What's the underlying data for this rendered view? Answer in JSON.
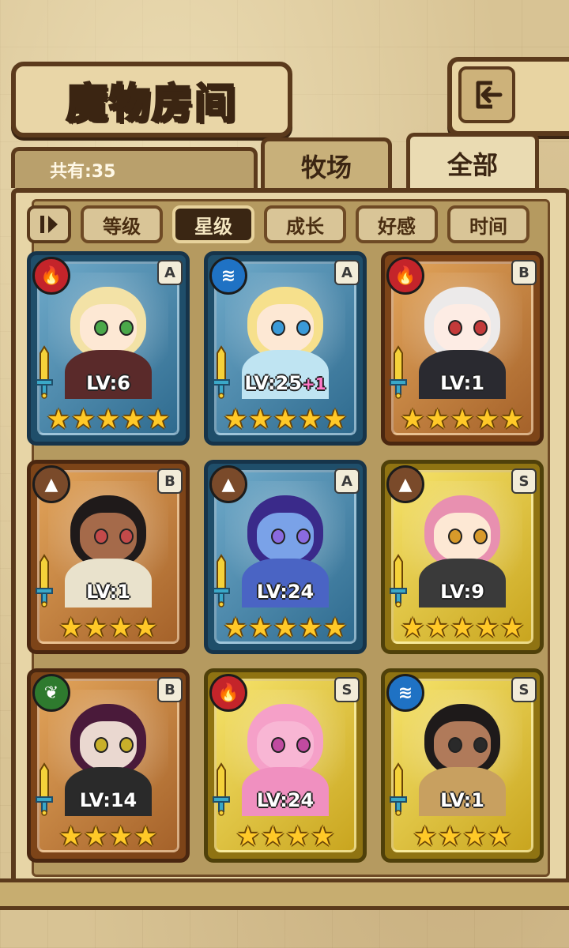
{
  "header": {
    "title": "魔物房间"
  },
  "tabs": {
    "farm": "牧场",
    "all": "全部"
  },
  "count": {
    "label": "共有:35"
  },
  "sort": {
    "buttons": [
      "等级",
      "星级",
      "成长",
      "好感",
      "时间"
    ],
    "active": "星级"
  },
  "colors": {
    "fire": "#c4242a",
    "water": "#1f72c4",
    "earth": "#7a4a2a",
    "wood": "#2e7a2e",
    "star": "#ffc928",
    "frame_dark": "#5b3a1c"
  },
  "monsters": [
    {
      "element": "fire-icon",
      "rank": "A",
      "level": "LV:6",
      "plus": "",
      "stars": 5
    },
    {
      "element": "water-icon",
      "rank": "A",
      "level": "LV:25",
      "plus": "+1",
      "stars": 5
    },
    {
      "element": "fire-icon",
      "rank": "B",
      "level": "LV:1",
      "plus": "",
      "stars": 5
    },
    {
      "element": "earth-icon",
      "rank": "B",
      "level": "LV:1",
      "plus": "",
      "stars": 4
    },
    {
      "element": "earth-icon",
      "rank": "A",
      "level": "LV:24",
      "plus": "",
      "stars": 5
    },
    {
      "element": "earth-icon",
      "rank": "S",
      "level": "LV:9",
      "plus": "",
      "stars": 5
    },
    {
      "element": "wood-icon",
      "rank": "B",
      "level": "LV:14",
      "plus": "",
      "stars": 4
    },
    {
      "element": "fire-icon",
      "rank": "S",
      "level": "LV:24",
      "plus": "",
      "stars": 4
    },
    {
      "element": "water-icon",
      "rank": "S",
      "level": "LV:1",
      "plus": "",
      "stars": 4
    }
  ]
}
